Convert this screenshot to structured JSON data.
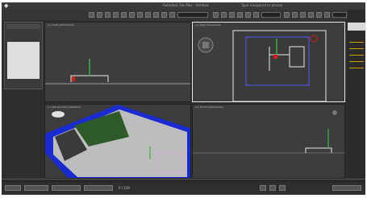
{
  "app": {
    "title": "Autodesk 3ds Max - Untitled",
    "center_title": "Type a keyword or phrase"
  },
  "viewports": {
    "top_left_label": "[+] [Left] [Wireframe]",
    "top_right_label": "[+] [Top] [Wireframe]",
    "bottom_left_label": "[+] [Perspective] [Realistic]",
    "bottom_right_label": "[+] [Front] [Wireframe]"
  },
  "timeline": {
    "frame_display": "0 / 100"
  },
  "icons": [
    "max-logo-icon",
    "select-icon",
    "move-icon",
    "rotate-icon",
    "scale-icon",
    "view-cube-icon",
    "axis-gizmo-icon",
    "play-icon"
  ],
  "colors": {
    "ui_dark": "#2e2e2e",
    "viewport": "#3d3d3d",
    "active_border": "#e8e8e8",
    "selection_blue": "#1a2bd1",
    "grass": "#2f5b2b",
    "pavement": "#c8c8c8"
  }
}
